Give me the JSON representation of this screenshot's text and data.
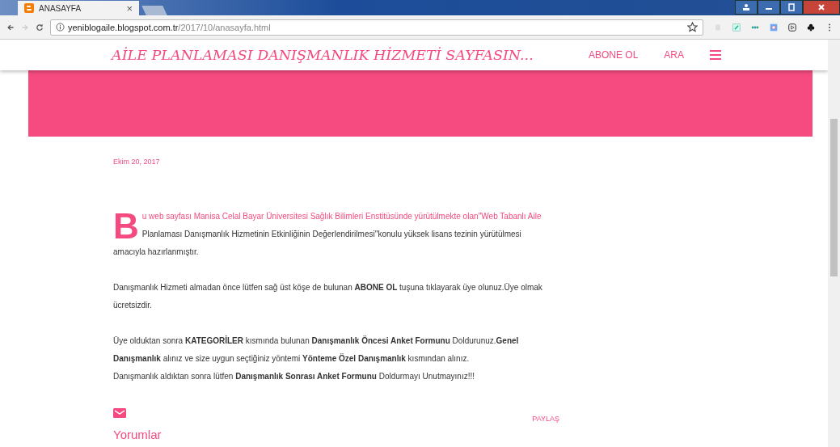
{
  "browser": {
    "tabs": [
      {
        "title": "ANASAYFA",
        "selected": true
      }
    ],
    "close_tab": "×",
    "address": {
      "host": "yeniblogaile.blogspot.com.tr",
      "path": "/2017/10/anasayfa.html"
    }
  },
  "header": {
    "title": "AİLE PLANLAMASI DANIŞMANLIK HİZMETİ SAYFASIN...",
    "links": [
      "ABONE OL",
      "ARA"
    ]
  },
  "post": {
    "date": "Ekim 20, 2017",
    "intro": {
      "drop_cap": "B",
      "lead": "u web sayfası Manisa Celal Bayar Üniversitesi Sağlık Bilimleri Enstitüsünde yürütülmekte olan''Web Tabanlı Aile",
      "body": "Planlaması Danışmanlık Hizmetinin Etkinliğinin Değerlendirilmesi''konulu yüksek lisans tezinin yürütülmesi",
      "tail": "amacıyla hazırlanmıştır."
    },
    "paragraphs": [
      [
        "Danışmanlık Hizmeti almadan önce lütfen sağ üst köşe de bulunan **ABONE OL** tuşuna tıklayarak üye olunuz.Üye olmak ücretsizdir."
      ],
      [
        "Üye olduktan sonra **KATEGORİLER** kısmında bulunan  **Danışmanlık Öncesi Anket Formunu** Doldurunuz.**Genel Danışmanlık** alınız ve size uygun seçtiğiniz yöntemi **Yönteme Özel Danışmanlık** kısmından alınız.",
        "Danışmanlık aldıktan sonra lütfen **Danışmanlık Sonrası Anket Formunu** Doldurmayı Unutmayınız!!!"
      ]
    ],
    "share": "PAYLAŞ",
    "comments_title": "Yorumlar"
  }
}
